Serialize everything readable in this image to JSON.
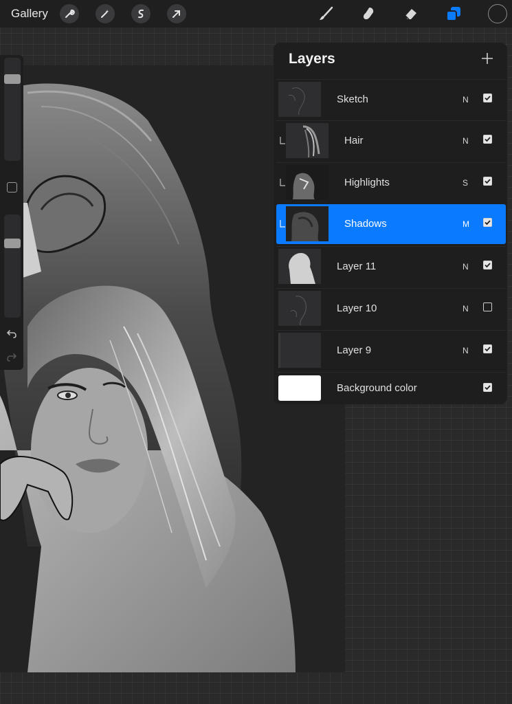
{
  "topbar": {
    "gallery_label": "Gallery",
    "left_tools": [
      "wrench-icon",
      "magic-wand-icon",
      "selection-icon",
      "transform-arrow-icon"
    ],
    "right_tools": [
      "brush-icon",
      "smudge-icon",
      "eraser-icon",
      "layers-icon"
    ],
    "active_color": "#1f1f20",
    "accent": "#0a7bff"
  },
  "layers_panel": {
    "title": "Layers",
    "layers": [
      {
        "name": "Sketch",
        "blend": "N",
        "visible": true,
        "clipped": false,
        "active": false
      },
      {
        "name": "Hair",
        "blend": "N",
        "visible": true,
        "clipped": true,
        "active": false
      },
      {
        "name": "Highlights",
        "blend": "S",
        "visible": true,
        "clipped": true,
        "active": false
      },
      {
        "name": "Shadows",
        "blend": "M",
        "visible": true,
        "clipped": true,
        "active": true
      },
      {
        "name": "Layer 11",
        "blend": "N",
        "visible": true,
        "clipped": false,
        "active": false
      },
      {
        "name": "Layer 10",
        "blend": "N",
        "visible": false,
        "clipped": false,
        "active": false
      },
      {
        "name": "Layer 9",
        "blend": "N",
        "visible": true,
        "clipped": false,
        "active": false
      }
    ],
    "background": {
      "name": "Background color",
      "visible": true,
      "color": "#ffffff"
    }
  },
  "sidebar": {
    "brush_size_level": 0.18,
    "opacity_level": 0.26
  }
}
